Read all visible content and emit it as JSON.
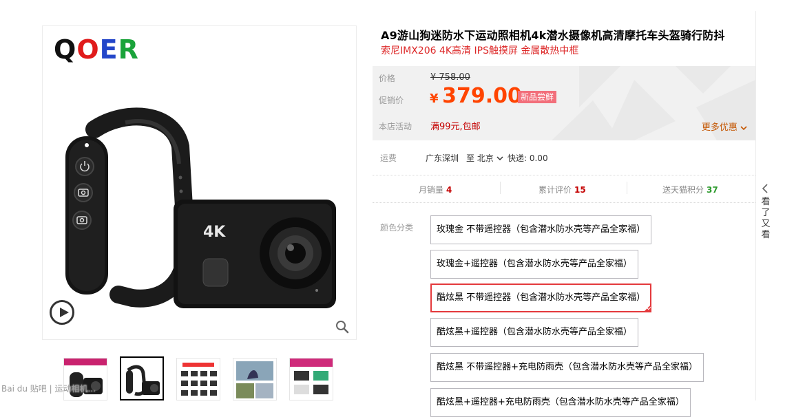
{
  "gallery": {
    "brand_letters": [
      {
        "char": "Q",
        "color": "#111111"
      },
      {
        "char": "O",
        "color": "#e01b1b"
      },
      {
        "char": "E",
        "color": "#2346c9"
      },
      {
        "char": "R",
        "color": "#1aa33a"
      }
    ],
    "camera_badge": "4K",
    "play_icon": "play-icon",
    "zoom_icon": "zoom-icon",
    "thumb_count": 5,
    "watermark": "Bai du 贴吧 | 运动相机..."
  },
  "product": {
    "title": "A9游山狗迷防水下运动照相机4k潜水摄像机高清摩托车头盔骑行防抖",
    "subtitle": "索尼IMX206 4K高清 IPS触摸屏 金属散热中框"
  },
  "pricing": {
    "price_label": "价格",
    "original_price": "¥ 758.00",
    "promo_label": "促销价",
    "currency": "¥",
    "promo_price": "379.00",
    "badge": "新品尝鲜",
    "activity_label": "本店活动",
    "activity_value": "满99元,包邮",
    "more_deals": "更多优惠",
    "accent_color": "#ff0036"
  },
  "shipping": {
    "label": "运费",
    "from": "广东深圳",
    "to": "至 北京",
    "fee": "快递: 0.00"
  },
  "stats": [
    {
      "label": "月销量",
      "value": "4"
    },
    {
      "label": "累计评价",
      "value": "15"
    },
    {
      "label": "送天猫积分",
      "value": "37"
    }
  ],
  "sku": {
    "label": "颜色分类",
    "options": [
      "玫瑰金 不带遥控器（包含潜水防水壳等产品全家福）",
      "玫瑰金+遥控器（包含潜水防水壳等产品全家福）",
      "酷炫黑 不带遥控器（包含潜水防水壳等产品全家福）",
      "酷炫黑+遥控器（包含潜水防水壳等产品全家福）",
      "酷炫黑 不带遥控器+充电防雨壳（包含潜水防水壳等产品全家福）",
      "酷炫黑+遥控器+充电防雨壳（包含潜水防水壳等产品全家福）"
    ],
    "selected_index": 2
  },
  "sidebar": {
    "see_also": [
      "看",
      "了",
      "又",
      "看"
    ]
  }
}
